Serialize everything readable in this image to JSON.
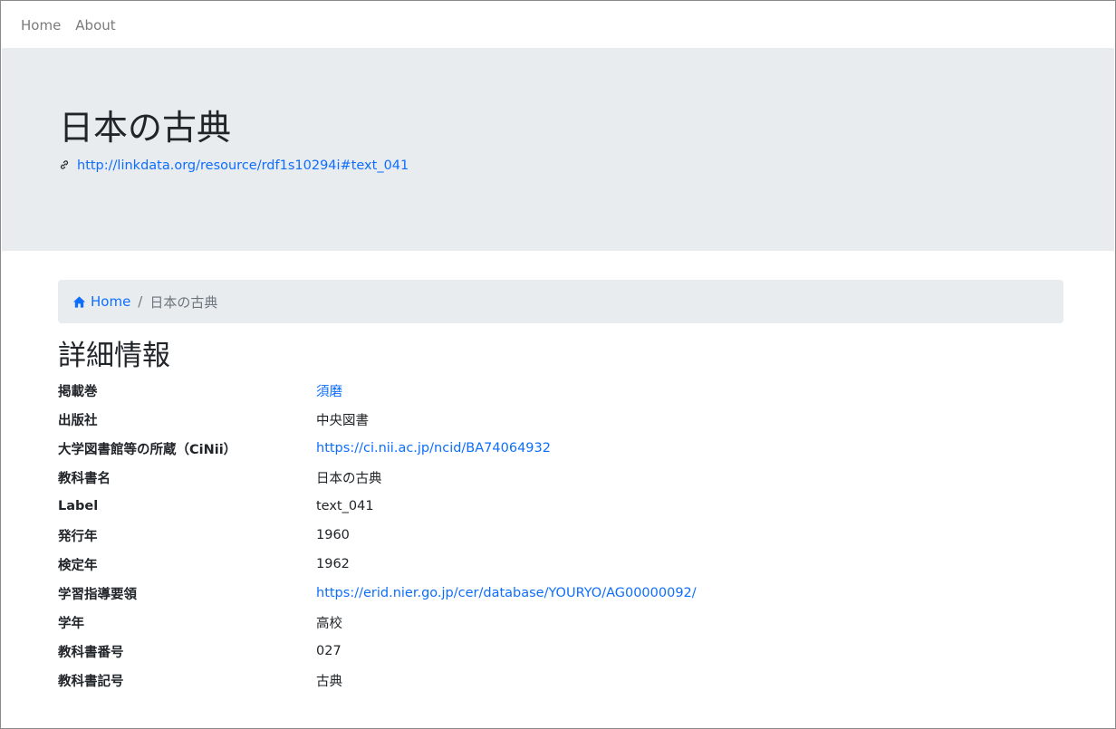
{
  "nav": {
    "items": [
      {
        "label": "Home"
      },
      {
        "label": "About"
      }
    ]
  },
  "hero": {
    "title": "日本の古典",
    "uri": "http://linkdata.org/resource/rdf1s10294i#text_041",
    "uri_icon": "link-icon"
  },
  "breadcrumb": {
    "home_icon": "home-icon",
    "home_label": "Home",
    "separator": "/",
    "current": "日本の古典"
  },
  "details": {
    "heading": "詳細情報",
    "rows": [
      {
        "key": "掲載巻",
        "value": "須磨",
        "link": true
      },
      {
        "key": "出版社",
        "value": "中央図書",
        "link": false
      },
      {
        "key": "大学図書館等の所蔵（CiNii）",
        "value": "https://ci.nii.ac.jp/ncid/BA74064932",
        "link": true
      },
      {
        "key": "教科書名",
        "value": "日本の古典",
        "link": false
      },
      {
        "key": "Label",
        "value": "text_041",
        "link": false
      },
      {
        "key": "発行年",
        "value": "1960",
        "link": false
      },
      {
        "key": "検定年",
        "value": "1962",
        "link": false
      },
      {
        "key": "学習指導要領",
        "value": "https://erid.nier.go.jp/cer/database/YOURYO/AG00000092/",
        "link": true
      },
      {
        "key": "学年",
        "value": "高校",
        "link": false
      },
      {
        "key": "教科書番号",
        "value": "027",
        "link": false
      },
      {
        "key": "教科書記号",
        "value": "古典",
        "link": false
      }
    ]
  },
  "colors": {
    "link": "#0d6efd",
    "jumbotron_bg": "#e9ecef",
    "nav_text": "#7b7b7b"
  }
}
